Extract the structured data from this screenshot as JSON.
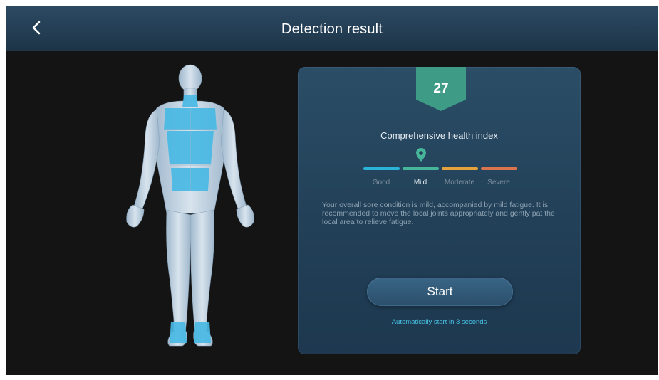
{
  "header": {
    "title": "Detection result",
    "back_icon": "chevron-left-icon"
  },
  "result": {
    "score": "27",
    "index_title": "Comprehensive health index",
    "marker_icon": "location-pin-icon",
    "selected_level": "Mild",
    "levels": [
      {
        "label": "Good",
        "color": "#2bb3d8"
      },
      {
        "label": "Mild",
        "color": "#46b59a"
      },
      {
        "label": "Moderate",
        "color": "#e6a23c"
      },
      {
        "label": "Severe",
        "color": "#d9744e"
      }
    ],
    "description": "Your overall sore condition is mild, accompanied by mild fatigue. It is recommended to move the local joints appropriately and gently pat the local area to relieve fatigue.",
    "start_label": "Start",
    "auto_start_text": "Automatically start in 3 seconds"
  },
  "colors": {
    "highlight": "#49b9e4",
    "badge": "#3e9b86",
    "accent_text": "#47c4e6"
  }
}
